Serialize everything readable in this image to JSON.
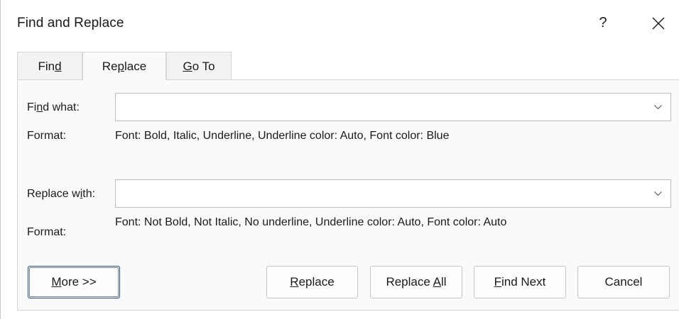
{
  "window": {
    "title": "Find and Replace",
    "help_label": "?",
    "close_icon": "close-icon"
  },
  "tabs": [
    {
      "pre": "Fin",
      "mnemonic": "d",
      "post": "",
      "active": false
    },
    {
      "pre": "Re",
      "mnemonic": "p",
      "post": "lace",
      "active": true
    },
    {
      "pre": "",
      "mnemonic": "G",
      "post": "o To",
      "active": false
    }
  ],
  "find": {
    "label_pre": "Fi",
    "label_mnemonic": "n",
    "label_post": "d what:",
    "value": "",
    "format_label": "Format:",
    "format_value": "Font: Bold, Italic, Underline, Underline color: Auto, Font color: Blue"
  },
  "replace": {
    "label_pre": "Replace w",
    "label_mnemonic": "i",
    "label_post": "th:",
    "value": "",
    "format_label": "Format:",
    "format_value": "Font: Not Bold, Not Italic, No underline, Underline color: Auto, Font color: Auto"
  },
  "buttons": {
    "more": {
      "pre": "",
      "mnemonic": "M",
      "post": "ore >>"
    },
    "replace": {
      "pre": "",
      "mnemonic": "R",
      "post": "eplace"
    },
    "replace_all": {
      "pre": "Replace ",
      "mnemonic": "A",
      "post": "ll"
    },
    "find_next": {
      "pre": "",
      "mnemonic": "F",
      "post": "ind Next"
    },
    "cancel": {
      "pre": "Cancel",
      "mnemonic": "",
      "post": ""
    }
  },
  "colors": {
    "accent_focus": "#2b4a7a",
    "panel_bg": "#fafafa",
    "tab_bg": "#f3f3f3"
  }
}
